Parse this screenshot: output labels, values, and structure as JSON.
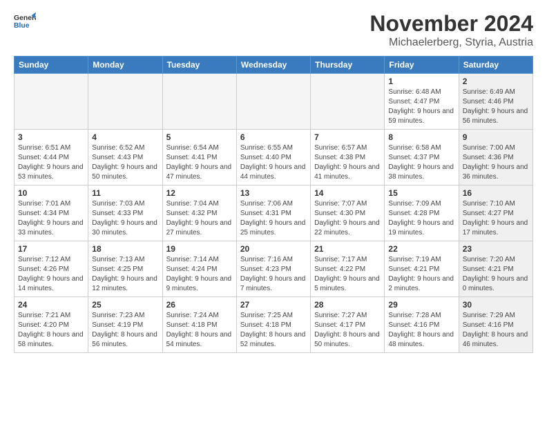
{
  "logo": {
    "line1": "General",
    "line2": "Blue"
  },
  "header": {
    "month": "November 2024",
    "location": "Michaelerberg, Styria, Austria"
  },
  "weekdays": [
    "Sunday",
    "Monday",
    "Tuesday",
    "Wednesday",
    "Thursday",
    "Friday",
    "Saturday"
  ],
  "weeks": [
    [
      {
        "day": "",
        "detail": "",
        "empty": true
      },
      {
        "day": "",
        "detail": "",
        "empty": true
      },
      {
        "day": "",
        "detail": "",
        "empty": true
      },
      {
        "day": "",
        "detail": "",
        "empty": true
      },
      {
        "day": "",
        "detail": "",
        "empty": true
      },
      {
        "day": "1",
        "detail": "Sunrise: 6:48 AM\nSunset: 4:47 PM\nDaylight: 9 hours and 59 minutes.",
        "shade": false
      },
      {
        "day": "2",
        "detail": "Sunrise: 6:49 AM\nSunset: 4:46 PM\nDaylight: 9 hours and 56 minutes.",
        "shade": true
      }
    ],
    [
      {
        "day": "3",
        "detail": "Sunrise: 6:51 AM\nSunset: 4:44 PM\nDaylight: 9 hours and 53 minutes.",
        "shade": false
      },
      {
        "day": "4",
        "detail": "Sunrise: 6:52 AM\nSunset: 4:43 PM\nDaylight: 9 hours and 50 minutes.",
        "shade": false
      },
      {
        "day": "5",
        "detail": "Sunrise: 6:54 AM\nSunset: 4:41 PM\nDaylight: 9 hours and 47 minutes.",
        "shade": false
      },
      {
        "day": "6",
        "detail": "Sunrise: 6:55 AM\nSunset: 4:40 PM\nDaylight: 9 hours and 44 minutes.",
        "shade": false
      },
      {
        "day": "7",
        "detail": "Sunrise: 6:57 AM\nSunset: 4:38 PM\nDaylight: 9 hours and 41 minutes.",
        "shade": false
      },
      {
        "day": "8",
        "detail": "Sunrise: 6:58 AM\nSunset: 4:37 PM\nDaylight: 9 hours and 38 minutes.",
        "shade": false
      },
      {
        "day": "9",
        "detail": "Sunrise: 7:00 AM\nSunset: 4:36 PM\nDaylight: 9 hours and 36 minutes.",
        "shade": true
      }
    ],
    [
      {
        "day": "10",
        "detail": "Sunrise: 7:01 AM\nSunset: 4:34 PM\nDaylight: 9 hours and 33 minutes.",
        "shade": false
      },
      {
        "day": "11",
        "detail": "Sunrise: 7:03 AM\nSunset: 4:33 PM\nDaylight: 9 hours and 30 minutes.",
        "shade": false
      },
      {
        "day": "12",
        "detail": "Sunrise: 7:04 AM\nSunset: 4:32 PM\nDaylight: 9 hours and 27 minutes.",
        "shade": false
      },
      {
        "day": "13",
        "detail": "Sunrise: 7:06 AM\nSunset: 4:31 PM\nDaylight: 9 hours and 25 minutes.",
        "shade": false
      },
      {
        "day": "14",
        "detail": "Sunrise: 7:07 AM\nSunset: 4:30 PM\nDaylight: 9 hours and 22 minutes.",
        "shade": false
      },
      {
        "day": "15",
        "detail": "Sunrise: 7:09 AM\nSunset: 4:28 PM\nDaylight: 9 hours and 19 minutes.",
        "shade": false
      },
      {
        "day": "16",
        "detail": "Sunrise: 7:10 AM\nSunset: 4:27 PM\nDaylight: 9 hours and 17 minutes.",
        "shade": true
      }
    ],
    [
      {
        "day": "17",
        "detail": "Sunrise: 7:12 AM\nSunset: 4:26 PM\nDaylight: 9 hours and 14 minutes.",
        "shade": false
      },
      {
        "day": "18",
        "detail": "Sunrise: 7:13 AM\nSunset: 4:25 PM\nDaylight: 9 hours and 12 minutes.",
        "shade": false
      },
      {
        "day": "19",
        "detail": "Sunrise: 7:14 AM\nSunset: 4:24 PM\nDaylight: 9 hours and 9 minutes.",
        "shade": false
      },
      {
        "day": "20",
        "detail": "Sunrise: 7:16 AM\nSunset: 4:23 PM\nDaylight: 9 hours and 7 minutes.",
        "shade": false
      },
      {
        "day": "21",
        "detail": "Sunrise: 7:17 AM\nSunset: 4:22 PM\nDaylight: 9 hours and 5 minutes.",
        "shade": false
      },
      {
        "day": "22",
        "detail": "Sunrise: 7:19 AM\nSunset: 4:21 PM\nDaylight: 9 hours and 2 minutes.",
        "shade": false
      },
      {
        "day": "23",
        "detail": "Sunrise: 7:20 AM\nSunset: 4:21 PM\nDaylight: 9 hours and 0 minutes.",
        "shade": true
      }
    ],
    [
      {
        "day": "24",
        "detail": "Sunrise: 7:21 AM\nSunset: 4:20 PM\nDaylight: 8 hours and 58 minutes.",
        "shade": false
      },
      {
        "day": "25",
        "detail": "Sunrise: 7:23 AM\nSunset: 4:19 PM\nDaylight: 8 hours and 56 minutes.",
        "shade": false
      },
      {
        "day": "26",
        "detail": "Sunrise: 7:24 AM\nSunset: 4:18 PM\nDaylight: 8 hours and 54 minutes.",
        "shade": false
      },
      {
        "day": "27",
        "detail": "Sunrise: 7:25 AM\nSunset: 4:18 PM\nDaylight: 8 hours and 52 minutes.",
        "shade": false
      },
      {
        "day": "28",
        "detail": "Sunrise: 7:27 AM\nSunset: 4:17 PM\nDaylight: 8 hours and 50 minutes.",
        "shade": false
      },
      {
        "day": "29",
        "detail": "Sunrise: 7:28 AM\nSunset: 4:16 PM\nDaylight: 8 hours and 48 minutes.",
        "shade": false
      },
      {
        "day": "30",
        "detail": "Sunrise: 7:29 AM\nSunset: 4:16 PM\nDaylight: 8 hours and 46 minutes.",
        "shade": true
      }
    ]
  ]
}
